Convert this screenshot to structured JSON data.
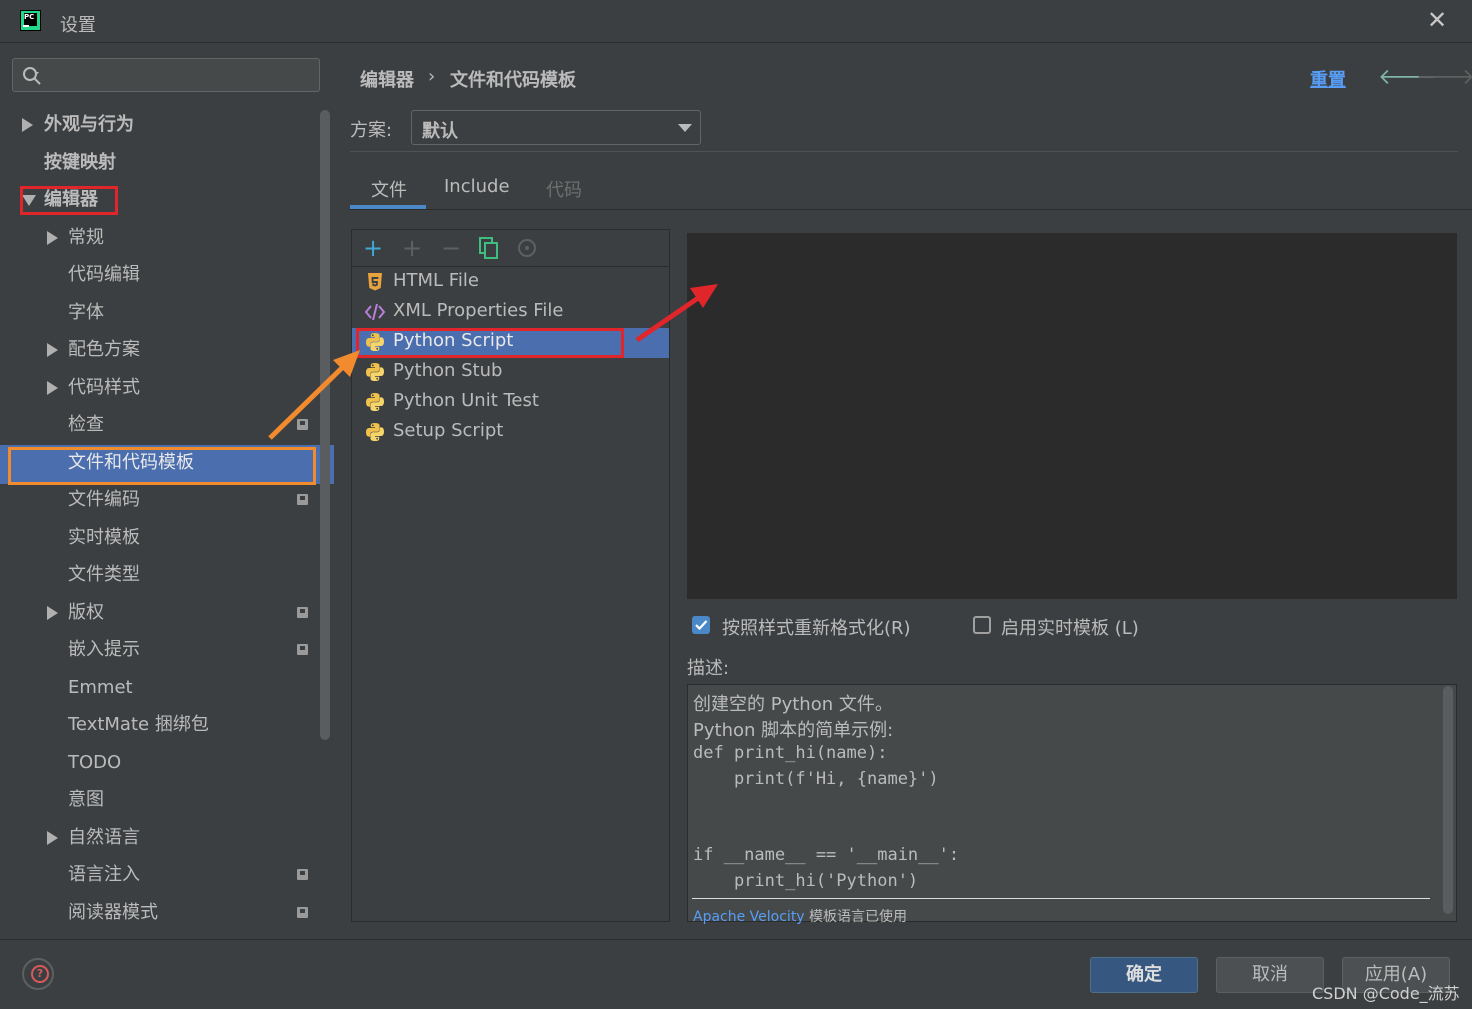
{
  "window": {
    "title": "设置",
    "close_glyph": "✕"
  },
  "search": {
    "placeholder": "",
    "icon": "search-icon"
  },
  "sidebar": {
    "items": [
      {
        "label": "外观与行为",
        "arrow": "right",
        "bold": true
      },
      {
        "label": "按键映射",
        "arrow": "none",
        "bold": true
      },
      {
        "label": "编辑器",
        "arrow": "down",
        "bold": true
      },
      {
        "label": "常规",
        "arrow": "right"
      },
      {
        "label": "代码编辑",
        "arrow": "none"
      },
      {
        "label": "字体",
        "arrow": "none"
      },
      {
        "label": "配色方案",
        "arrow": "right"
      },
      {
        "label": "代码样式",
        "arrow": "right"
      },
      {
        "label": "检查",
        "arrow": "none",
        "project": true
      },
      {
        "label": "文件和代码模板",
        "arrow": "none",
        "selected": true
      },
      {
        "label": "文件编码",
        "arrow": "none",
        "project": true
      },
      {
        "label": "实时模板",
        "arrow": "none"
      },
      {
        "label": "文件类型",
        "arrow": "none"
      },
      {
        "label": "版权",
        "arrow": "right",
        "project": true
      },
      {
        "label": "嵌入提示",
        "arrow": "none",
        "project": true
      },
      {
        "label": "Emmet",
        "arrow": "none"
      },
      {
        "label": "TextMate 捆绑包",
        "arrow": "none"
      },
      {
        "label": "TODO",
        "arrow": "none"
      },
      {
        "label": "意图",
        "arrow": "none"
      },
      {
        "label": "自然语言",
        "arrow": "right"
      },
      {
        "label": "语言注入",
        "arrow": "none",
        "project": true
      },
      {
        "label": "阅读器模式",
        "arrow": "none",
        "project": true
      }
    ]
  },
  "breadcrumb": {
    "parent": "编辑器",
    "separator": "›",
    "current": "文件和代码模板"
  },
  "header_actions": {
    "reset": "重置",
    "back_glyph": "🡐",
    "forward_glyph": "🡒"
  },
  "scheme": {
    "label": "方案:",
    "value": "默认"
  },
  "tabs": [
    {
      "label": "文件",
      "active": true
    },
    {
      "label": "Include",
      "active": false
    },
    {
      "label": "代码",
      "active": false,
      "disabled": true
    }
  ],
  "toolbar": {
    "add": "+",
    "add_child": "+",
    "remove": "−"
  },
  "templates": [
    {
      "label": "HTML File",
      "icon": "html5-icon"
    },
    {
      "label": "XML Properties File",
      "icon": "xml-icon"
    },
    {
      "label": "Python Script",
      "icon": "python-icon",
      "selected": true
    },
    {
      "label": "Python Stub",
      "icon": "python-icon"
    },
    {
      "label": "Python Unit Test",
      "icon": "python-icon"
    },
    {
      "label": "Setup Script",
      "icon": "python-icon"
    }
  ],
  "options": {
    "reformat": {
      "label": "按照样式重新格式化(R)",
      "checked": true
    },
    "live_templates": {
      "label": "启用实时模板 (L)",
      "checked": false
    }
  },
  "description": {
    "label": "描述:",
    "line1": "创建空的 Python 文件。",
    "line2": "Python 脚本的简单示例:",
    "code1": "def print_hi(name):",
    "code2": "    print(f'Hi, {name}')",
    "code3": "if __name__ == '__main__':",
    "code4": "    print_hi('Python')",
    "footer_link": "Apache Velocity",
    "footer_text": " 模板语言已使用"
  },
  "buttons": {
    "ok": "确定",
    "cancel": "取消",
    "apply": "应用(A)"
  },
  "watermark": "CSDN @Code_流苏",
  "colors": {
    "selection": "#4b6eaf",
    "accent": "#4a88c7",
    "link": "#589df6",
    "annotation_red": "#e0262b",
    "annotation_orange": "#f28a2e"
  }
}
